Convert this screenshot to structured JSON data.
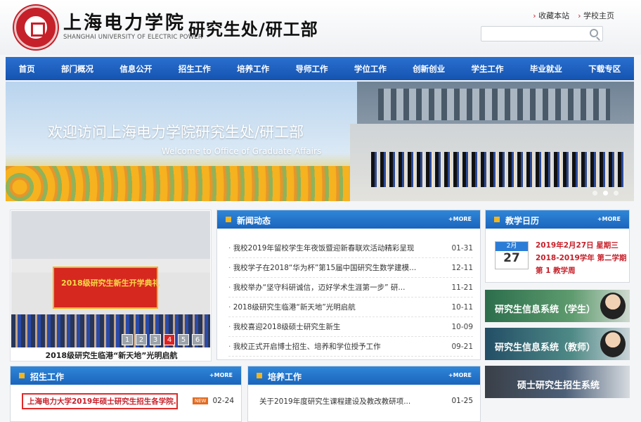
{
  "header": {
    "school_name_cn": "上海电力学院",
    "school_name_en": "SHANGHAI UNIVERSITY OF ELECTRIC POWER",
    "dept_title": "研究生处/研工部",
    "top_links": [
      "收藏本站",
      "学校主页"
    ],
    "search_placeholder": ""
  },
  "nav": [
    "首页",
    "部门概况",
    "信息公开",
    "招生工作",
    "培养工作",
    "导师工作",
    "学位工作",
    "创新创业",
    "学生工作",
    "毕业就业",
    "下载专区"
  ],
  "banner": {
    "title_cn": "欢迎访问上海电力学院研究生处/研工部",
    "title_en": "Welcome to Office of Graduate Affairs",
    "active_dot": 2,
    "dot_count": 3
  },
  "photo": {
    "stage_text": "2018级研究生新生开学典礼",
    "caption": "2018级研究生临港“新天地”光明启航",
    "pages": [
      "1",
      "2",
      "3",
      "4",
      "5",
      "6"
    ],
    "active_page": "4"
  },
  "news": {
    "title": "新闻动态",
    "more": "+MORE",
    "items": [
      {
        "text": "我校2019年留校学生年夜饭暨迎新春联欢活动精彩呈现",
        "date": "01-31"
      },
      {
        "text": "我校学子在2018“华为杯”第15届中国研究生数学建模...",
        "date": "12-11"
      },
      {
        "text": "我校举办“坚守科研诚信，迈好学术生涯第一步” 研...",
        "date": "11-21"
      },
      {
        "text": "2018级研究生临港“新天地”光明启航",
        "date": "10-11"
      },
      {
        "text": "我校喜迎2018级硕士研究生新生",
        "date": "10-09"
      },
      {
        "text": "我校正式开启博士招生、培养和学位授予工作",
        "date": "09-21"
      }
    ]
  },
  "calendar": {
    "title": "教学日历",
    "more": "+MORE",
    "month": "2月",
    "day": "27",
    "line1": "2019年2月27日 星期三",
    "line2": "2018-2019学年 第二学期",
    "line3": "第 1 教学周"
  },
  "systems": {
    "student": "研究生信息系统（学生）",
    "teacher": "研究生信息系统（教师）",
    "recruit": "硕士研究生招生系统"
  },
  "recruitment": {
    "title": "招生工作",
    "more": "+MORE",
    "item_text": "上海电力大学2019年硕士研究生招生各学院...",
    "tag": "NEW",
    "item_date": "02-24"
  },
  "training": {
    "title": "培养工作",
    "more": "+MORE",
    "item_text": "关于2019年度研究生课程建设及教改教研项...",
    "item_date": "01-25"
  }
}
